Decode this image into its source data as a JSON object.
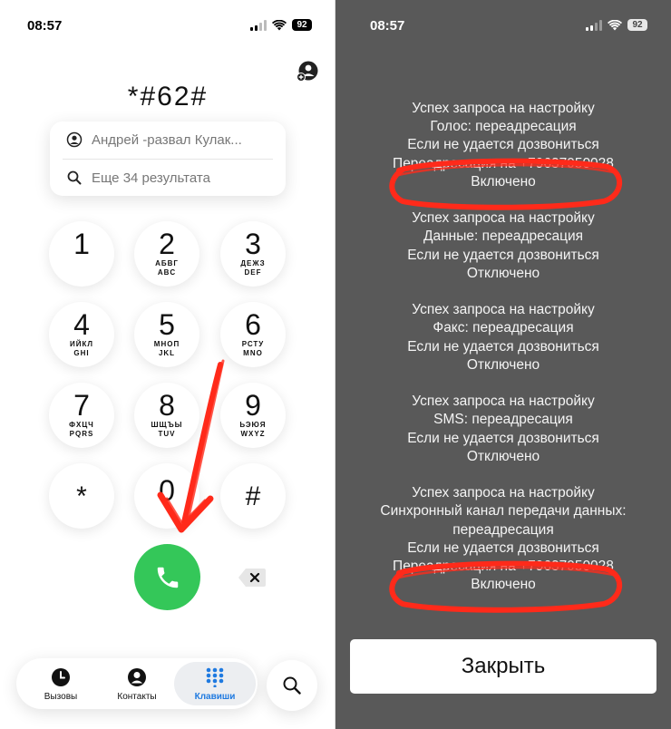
{
  "left": {
    "status": {
      "time": "08:57",
      "battery": "92"
    },
    "dial_number": "*#62#",
    "suggestions": [
      {
        "icon": "person-circle-icon",
        "text": "Андрей -развал Кулак..."
      },
      {
        "icon": "search-icon",
        "text": "Еще 34 результата"
      }
    ],
    "keys": [
      {
        "digit": "1",
        "l1": "",
        "l2": ""
      },
      {
        "digit": "2",
        "l1": "АБВГ",
        "l2": "ABC"
      },
      {
        "digit": "3",
        "l1": "ДЕЖЗ",
        "l2": "DEF"
      },
      {
        "digit": "4",
        "l1": "ИЙКЛ",
        "l2": "GHI"
      },
      {
        "digit": "5",
        "l1": "МНОП",
        "l2": "JKL"
      },
      {
        "digit": "6",
        "l1": "РСТУ",
        "l2": "MNO"
      },
      {
        "digit": "7",
        "l1": "ФХЦЧ",
        "l2": "PQRS"
      },
      {
        "digit": "8",
        "l1": "ШЩЪЫ",
        "l2": "TUV"
      },
      {
        "digit": "9",
        "l1": "ЬЭЮЯ",
        "l2": "WXYZ"
      },
      {
        "digit": "*"
      },
      {
        "digit": "0"
      },
      {
        "digit": "#"
      }
    ],
    "tabs": [
      {
        "label": "Вызовы",
        "icon": "clock-icon"
      },
      {
        "label": "Контакты",
        "icon": "person-icon"
      },
      {
        "label": "Клавиши",
        "icon": "keypad-icon",
        "active": true
      }
    ],
    "colors": {
      "call_green": "#34c759",
      "active_tab_blue": "#1f7ae0",
      "annotation_red": "#ff2a1a"
    }
  },
  "right": {
    "status": {
      "time": "08:57",
      "battery": "92"
    },
    "results": [
      {
        "lines": [
          "Успех запроса на настройку",
          "Голос: переадресация",
          "Если не удается дозвониться",
          "Переадресация на +79637950028",
          "Включено"
        ]
      },
      {
        "lines": [
          "Успех запроса на настройку",
          "Данные: переадресация",
          "Если не удается дозвониться",
          "Отключено"
        ]
      },
      {
        "lines": [
          "Успех запроса на настройку",
          "Факс: переадресация",
          "Если не удается дозвониться",
          "Отключено"
        ]
      },
      {
        "lines": [
          "Успех запроса на настройку",
          "SMS: переадресация",
          "Если не удается дозвониться",
          "Отключено"
        ]
      },
      {
        "lines": [
          "Успех запроса на настройку",
          "Синхронный канал передачи данных:",
          "переадресация",
          "Если не удается дозвониться",
          "Переадресация на +79637950028",
          "Включено"
        ]
      }
    ],
    "close_label": "Закрыть",
    "colors": {
      "background": "#595959"
    }
  }
}
